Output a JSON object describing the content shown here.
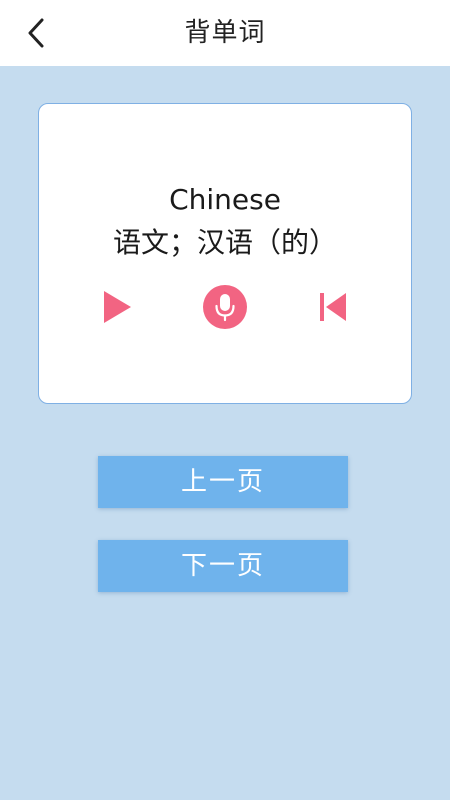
{
  "header": {
    "title": "背单词",
    "back_icon": "chevron-left-icon"
  },
  "card": {
    "word": "Chinese",
    "meaning": "语文；汉语（的）",
    "controls": {
      "play_icon": "play-icon",
      "mic_icon": "microphone-icon",
      "restart_icon": "skip-back-icon"
    }
  },
  "buttons": {
    "prev_label": "上一页",
    "next_label": "下一页"
  },
  "colors": {
    "background": "#c5dcef",
    "accent_pink": "#f26482",
    "button_blue": "#6fb3ec",
    "card_border": "#7fb0e4"
  }
}
